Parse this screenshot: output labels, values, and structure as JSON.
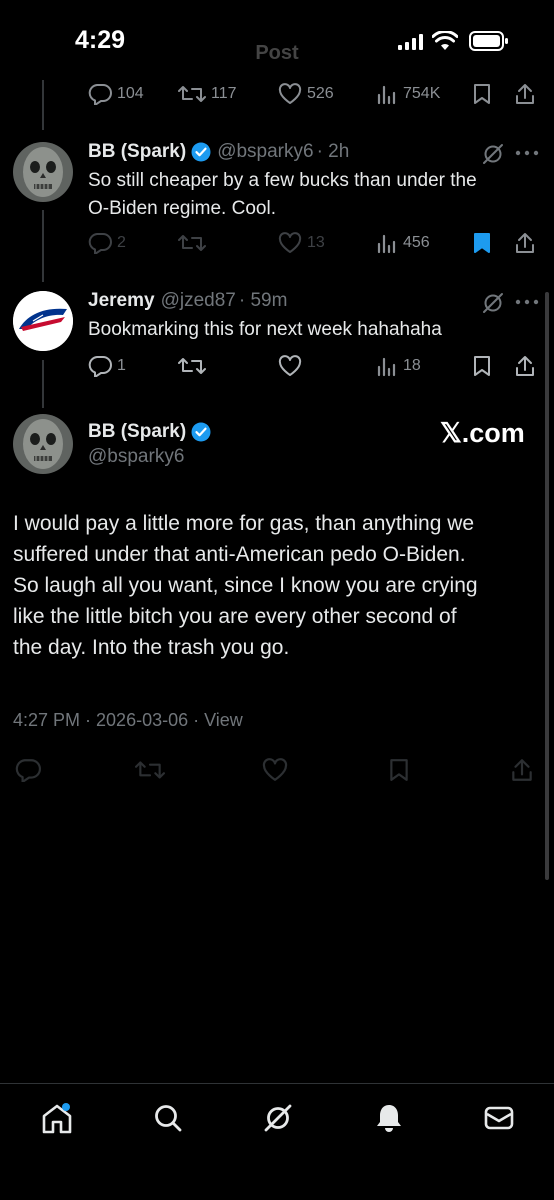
{
  "status_bar": {
    "time": "4:29"
  },
  "header": {
    "title": "Post"
  },
  "top_actions": {
    "replies": "104",
    "reposts": "117",
    "likes": "526",
    "views": "754K"
  },
  "reply1": {
    "display_name": "BB (Spark)",
    "handle": "@bsparky6",
    "time": "· 2h",
    "text_line1": "So still cheaper by a few bucks than under the",
    "text_line2": "O-Biden regime.  Cool.",
    "replies": "2",
    "reposts": "",
    "likes": "13",
    "views": "456"
  },
  "reply2": {
    "display_name": "Jeremy",
    "handle": "@jzed87",
    "time": "· 59m",
    "text": "Bookmarking this for next week hahahaha",
    "replies": "1",
    "reposts": "",
    "likes": "",
    "views": "18"
  },
  "main_post": {
    "display_name": "BB (Spark)",
    "handle": "@bsparky6",
    "watermark": "𝕏.com",
    "text_lines": [
      "I would pay a little more for gas, than anything we",
      "suffered under that anti-American pedo O-Biden.",
      "So laugh all you want, since I know you are crying",
      "like the little bitch you are every other second of",
      "the day.  Into the trash you go."
    ],
    "timestamp": "4:27 PM · 2026-03-06 · View"
  },
  "colors": {
    "accent": "#1d9bf0",
    "muted": "#71767b",
    "text": "#e7e9ea",
    "background": "#000000"
  },
  "icons": [
    "reply-icon",
    "repost-icon",
    "like-icon",
    "views-icon",
    "bookmark-icon",
    "share-icon",
    "grok-icon",
    "more-icon",
    "verified-icon",
    "home-icon",
    "search-icon",
    "bell-icon",
    "mail-icon"
  ]
}
